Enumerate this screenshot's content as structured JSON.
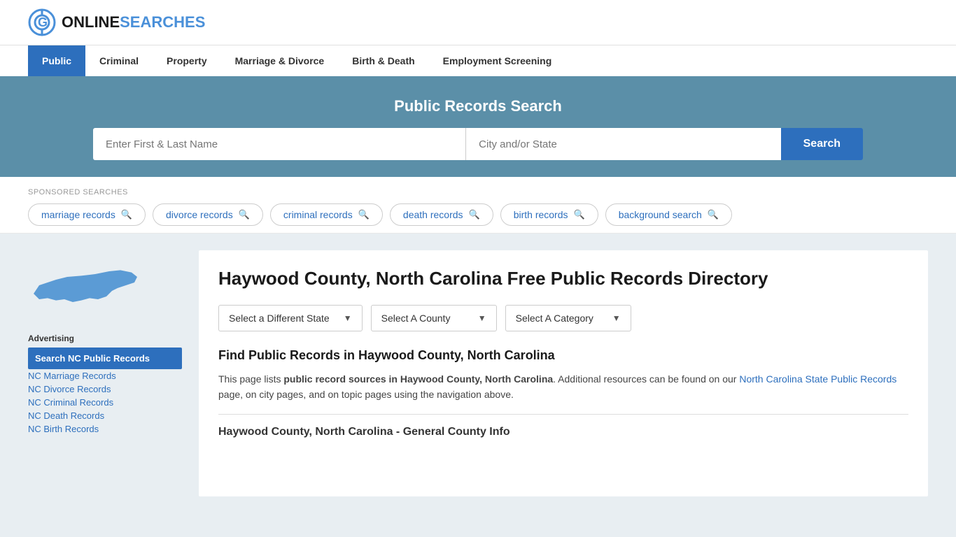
{
  "header": {
    "logo_text_online": "ONLINE",
    "logo_text_searches": "SEARCHES"
  },
  "nav": {
    "items": [
      {
        "label": "Public",
        "active": true
      },
      {
        "label": "Criminal",
        "active": false
      },
      {
        "label": "Property",
        "active": false
      },
      {
        "label": "Marriage & Divorce",
        "active": false
      },
      {
        "label": "Birth & Death",
        "active": false
      },
      {
        "label": "Employment Screening",
        "active": false
      }
    ]
  },
  "hero": {
    "title": "Public Records Search",
    "name_placeholder": "Enter First & Last Name",
    "location_placeholder": "City and/or State",
    "search_button": "Search"
  },
  "sponsored": {
    "label": "SPONSORED SEARCHES",
    "pills": [
      {
        "text": "marriage records"
      },
      {
        "text": "divorce records"
      },
      {
        "text": "criminal records"
      },
      {
        "text": "death records"
      },
      {
        "text": "birth records"
      },
      {
        "text": "background search"
      }
    ]
  },
  "sidebar": {
    "ad_label": "Advertising",
    "ad_item": "Search NC Public Records",
    "links": [
      "NC Marriage Records",
      "NC Divorce Records",
      "NC Criminal Records",
      "NC Death Records",
      "NC Birth Records"
    ]
  },
  "content": {
    "page_title": "Haywood County, North Carolina Free Public Records Directory",
    "dropdowns": {
      "state": "Select a Different State",
      "county": "Select A County",
      "category": "Select A Category"
    },
    "find_heading": "Find Public Records in Haywood County, North Carolina",
    "find_text_part1": "This page lists ",
    "find_text_bold": "public record sources in Haywood County, North Carolina",
    "find_text_part2": ". Additional resources can be found on our ",
    "find_text_link": "North Carolina State Public Records",
    "find_text_part3": " page, on city pages, and on topic pages using the navigation above.",
    "general_info_heading": "Haywood County, North Carolina - General County Info"
  }
}
